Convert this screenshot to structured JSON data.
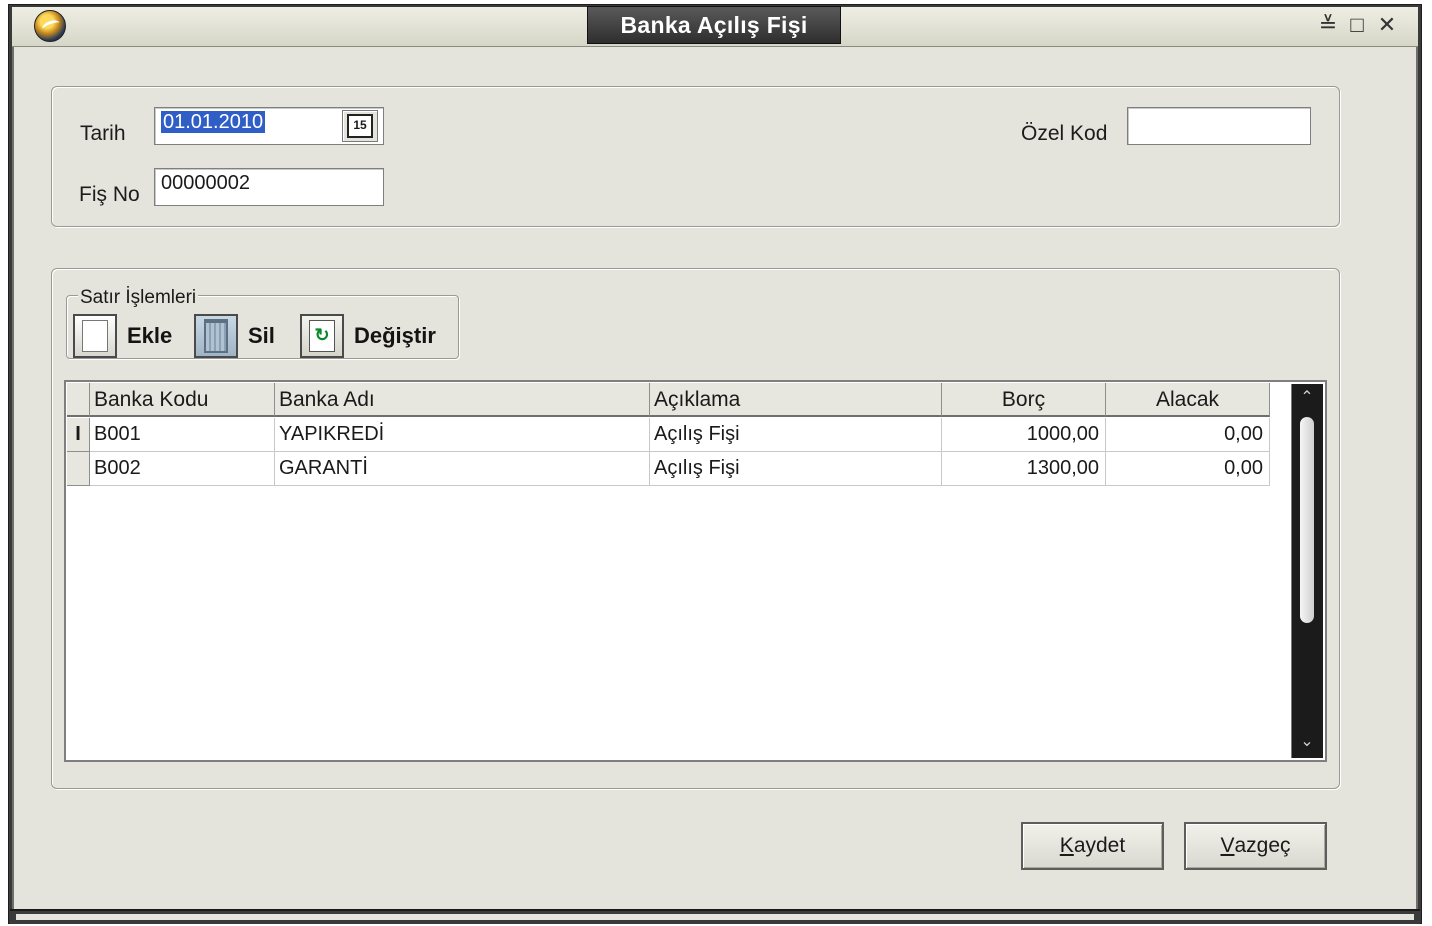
{
  "window": {
    "title": "Banka Açılış Fişi",
    "controls": {
      "minimize_icon": "≚",
      "maximize_icon": "□",
      "close_icon": "✕"
    }
  },
  "form": {
    "date_label": "Tarih",
    "date_value": "01.01.2010",
    "calendar_icon_text": "15",
    "receipt_no_label": "Fiş No",
    "receipt_no_value": "00000002",
    "special_code_label": "Özel Kod",
    "special_code_value": ""
  },
  "line_operations": {
    "legend": "Satır İşlemleri",
    "add_label": "Ekle",
    "delete_label": "Sil",
    "change_label": "Değiştir"
  },
  "grid": {
    "columns": [
      "Banka Kodu",
      "Banka Adı",
      "Açıklama",
      "Borç",
      "Alacak"
    ],
    "rows": [
      {
        "indicator": "I",
        "code": "B001",
        "name": "YAPIKREDİ",
        "description": "Açılış Fişi",
        "debit": "1000,00",
        "credit": "0,00"
      },
      {
        "indicator": "",
        "code": "B002",
        "name": "GARANTİ",
        "description": "Açılış Fişi",
        "debit": "1300,00",
        "credit": "0,00"
      }
    ],
    "scroll_up_icon": "⌃",
    "scroll_down_icon": "⌄"
  },
  "footer": {
    "save_mnemonic": "K",
    "save_rest": "aydet",
    "cancel_mnemonic": "V",
    "cancel_rest": "azgeç"
  },
  "colors": {
    "client_background": "#e4e3dc",
    "title_tab": "#3a3a3a",
    "selection": "#2f5ec6"
  },
  "icons": [
    "globe-app-icon",
    "calendar-icon",
    "new-document-icon",
    "trash-icon",
    "refresh-document-icon"
  ]
}
